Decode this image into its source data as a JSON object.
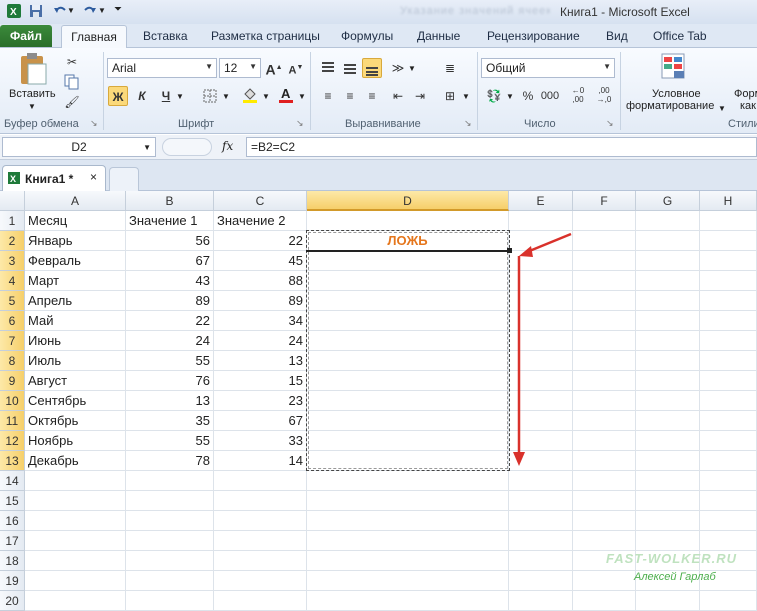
{
  "window": {
    "title": "Книга1  -  Microsoft Excel",
    "blurred_title": "Указание значений ячеек"
  },
  "ribbon_tabs": [
    "Файл",
    "Главная",
    "Вставка",
    "Разметка страницы",
    "Формулы",
    "Данные",
    "Рецензирование",
    "Вид",
    "Office Tab"
  ],
  "ribbon": {
    "paste_label": "Вставить",
    "font_name": "Arial",
    "font_size": "12",
    "bold": "Ж",
    "italic": "К",
    "underline": "Ч",
    "number_format": "Общий",
    "conditional_format_line1": "Условное",
    "conditional_format_line2": "форматирование",
    "next_btn_line1": "Форм",
    "next_btn_line2": "как",
    "groups": {
      "clipboard": "Буфер обмена",
      "font": "Шрифт",
      "alignment": "Выравнивание",
      "number": "Число",
      "styles": "Стили"
    }
  },
  "formula_bar": {
    "name_box": "D2",
    "fx": "fx",
    "formula": "=B2=C2"
  },
  "workbook_tab": {
    "label": "Книга1 *",
    "close": "×"
  },
  "columns": [
    "A",
    "B",
    "C",
    "D",
    "E",
    "F",
    "G",
    "H"
  ],
  "selected_column": "D",
  "headers": {
    "a": "Месяц",
    "b": "Значение 1",
    "c": "Значение 2"
  },
  "rows": [
    {
      "month": "Январь",
      "v1": "56",
      "v2": "22",
      "d": "ЛОЖЬ"
    },
    {
      "month": "Февраль",
      "v1": "67",
      "v2": "45",
      "d": ""
    },
    {
      "month": "Март",
      "v1": "43",
      "v2": "88",
      "d": ""
    },
    {
      "month": "Апрель",
      "v1": "89",
      "v2": "89",
      "d": ""
    },
    {
      "month": "Май",
      "v1": "22",
      "v2": "34",
      "d": ""
    },
    {
      "month": "Июнь",
      "v1": "24",
      "v2": "24",
      "d": ""
    },
    {
      "month": "Июль",
      "v1": "55",
      "v2": "13",
      "d": ""
    },
    {
      "month": "Август",
      "v1": "76",
      "v2": "15",
      "d": ""
    },
    {
      "month": "Сентябрь",
      "v1": "13",
      "v2": "23",
      "d": ""
    },
    {
      "month": "Октябрь",
      "v1": "35",
      "v2": "67",
      "d": ""
    },
    {
      "month": "Ноябрь",
      "v1": "55",
      "v2": "33",
      "d": ""
    },
    {
      "month": "Декабрь",
      "v1": "78",
      "v2": "14",
      "d": ""
    }
  ],
  "row_numbers": [
    "1",
    "2",
    "3",
    "4",
    "5",
    "6",
    "7",
    "8",
    "9",
    "10",
    "11",
    "12",
    "13",
    "14",
    "15",
    "16",
    "17",
    "18",
    "19",
    "20"
  ],
  "watermark": {
    "site": "FAST-WOLKER.RU",
    "author": "Алексей Гарлаб"
  },
  "colors": {
    "accent_arrow": "#d9312b",
    "result_text": "#e5761c",
    "selection": "#f6cf6a"
  }
}
